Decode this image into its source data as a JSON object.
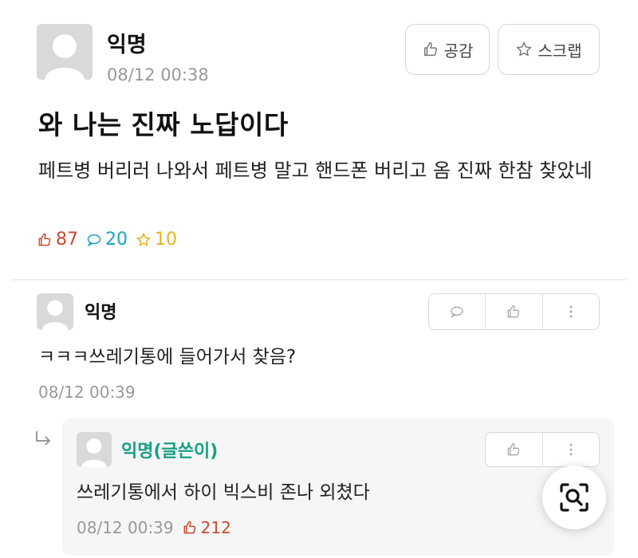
{
  "post": {
    "author": "익명",
    "time": "08/12 00:38",
    "like_button_label": "공감",
    "scrap_button_label": "스크랩",
    "title": "와 나는 진짜 노답이다",
    "body": "페트병 버리러 나와서 페트병 말고 핸드폰 버리고 옴 진짜 한참 찾았네",
    "stats": {
      "likes": "87",
      "comments": "20",
      "scraps": "10"
    }
  },
  "comment": {
    "author": "익명",
    "text": "ㅋㅋㅋ쓰레기통에 들어가서 찾음?",
    "time": "08/12 00:39"
  },
  "reply": {
    "author": "익명(글쓴이)",
    "text": "쓰레기통에서 하이 빅스비 존나 외쳤다",
    "time": "08/12 00:39",
    "likes": "212"
  },
  "colors": {
    "like": "#c84b31",
    "comment": "#1ba0c6",
    "scrap": "#e3b51d",
    "author_op": "#16a085"
  },
  "icons": [
    "thumbs-up-icon",
    "star-icon",
    "speech-bubble-icon",
    "more-vertical-icon",
    "reply-arrow-icon",
    "search-icon"
  ]
}
